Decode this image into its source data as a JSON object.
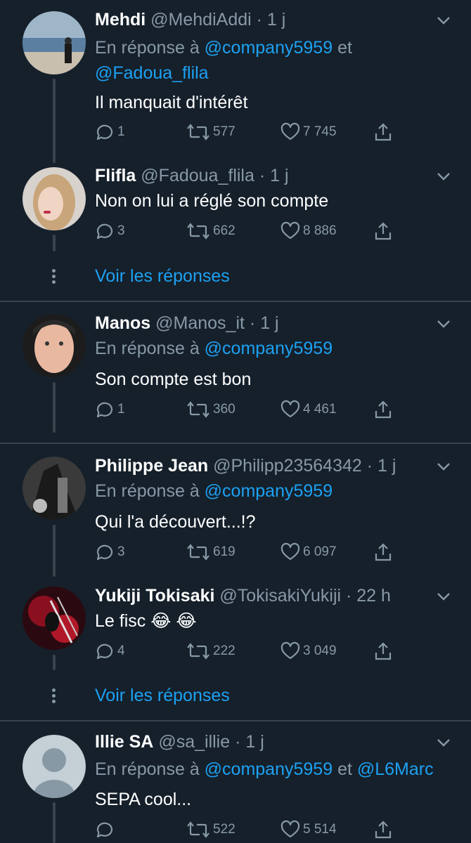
{
  "reply_prefix": "En réponse à",
  "and_word": "et",
  "see_replies": "Voir les réponses",
  "tweets": [
    {
      "name": "Mehdi",
      "handle": "@MehdiAddi",
      "time": "1 j",
      "reply_to": [
        "@company5959",
        "@Fadoua_flila"
      ],
      "text": "Il manquait d'intérêt",
      "replies": "1",
      "retweets": "577",
      "likes": "7 745"
    },
    {
      "name": "Flifla",
      "handle": "@Fadoua_flila",
      "time": "1 j",
      "text": "Non on lui a réglé son compte",
      "replies": "3",
      "retweets": "662",
      "likes": "8 886"
    },
    {
      "name": "Manos",
      "handle": "@Manos_it",
      "time": "1 j",
      "reply_to": [
        "@company5959"
      ],
      "text": "Son compte est bon",
      "replies": "1",
      "retweets": "360",
      "likes": "4 461"
    },
    {
      "name": "Philippe Jean",
      "handle": "@Philipp23564342",
      "time": "1 j",
      "reply_to": [
        "@company5959"
      ],
      "text": "Qui l'a découvert...!?",
      "replies": "3",
      "retweets": "619",
      "likes": "6 097"
    },
    {
      "name": "Yukiji Tokisaki",
      "handle": "@TokisakiYukiji",
      "time": "22 h",
      "text": "Le fisc 😂 😂",
      "replies": "4",
      "retweets": "222",
      "likes": "3 049"
    },
    {
      "name": "Illie SA",
      "handle": "@sa_illie",
      "time": "1 j",
      "reply_to": [
        "@company5959",
        "@L6Marc"
      ],
      "text": "SEPA cool...",
      "replies": "",
      "retweets": "522",
      "likes": "5 514"
    }
  ],
  "colors": {
    "background": "#15202b",
    "muted": "#8899a6",
    "link": "#1da1f2",
    "divider": "#38444d"
  },
  "icons": [
    "reply-icon",
    "retweet-icon",
    "like-icon",
    "share-icon",
    "chevron-down-icon",
    "more-dots-icon"
  ]
}
